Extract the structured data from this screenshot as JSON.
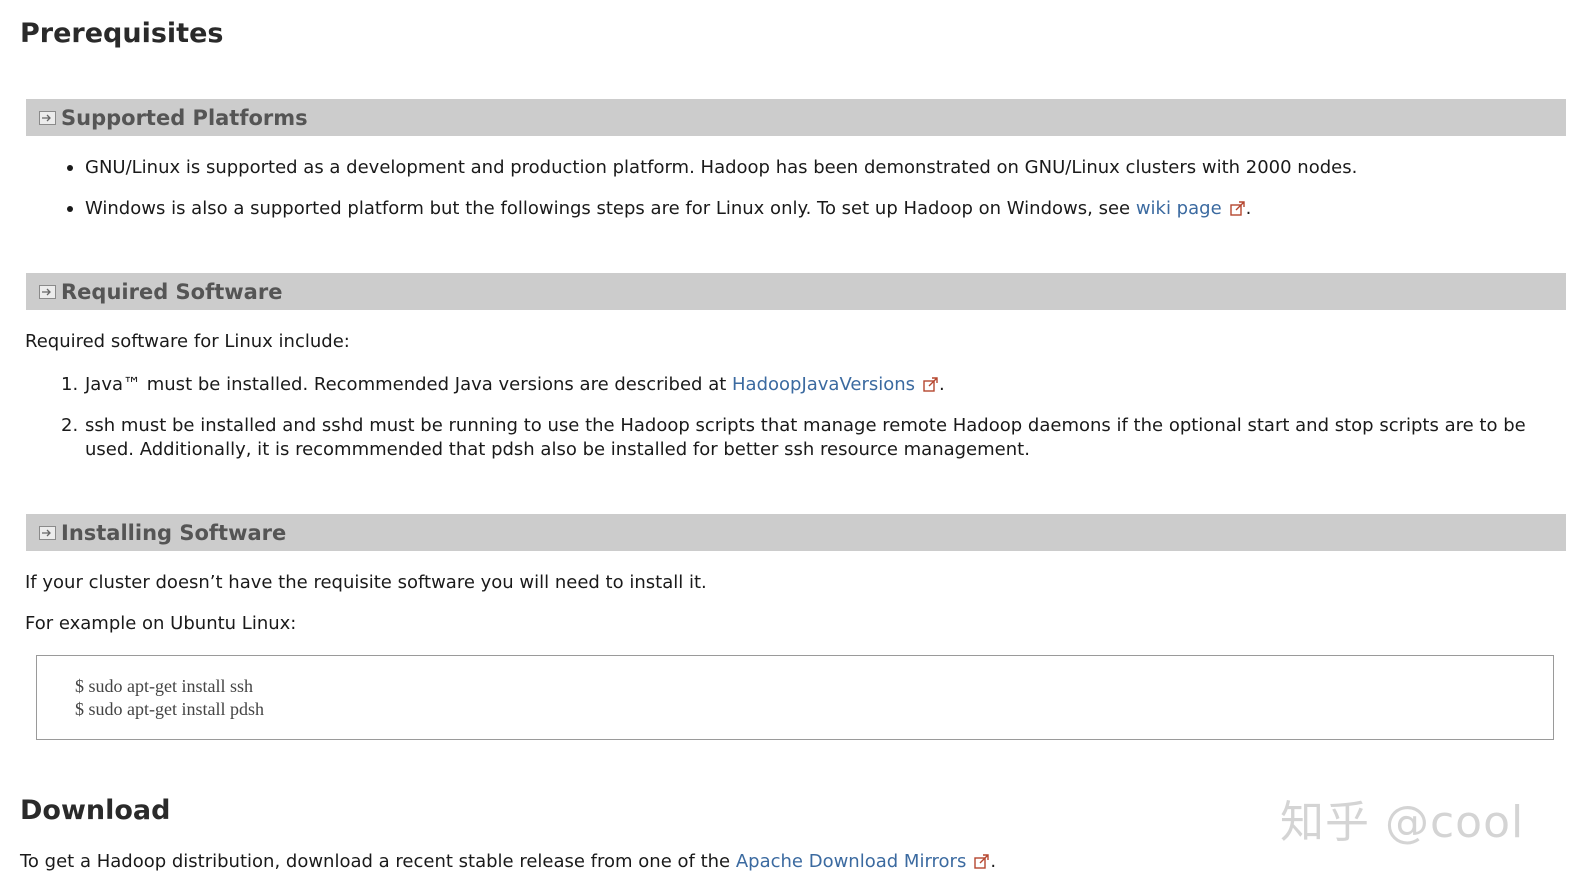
{
  "prerequisites": {
    "heading": "Prerequisites"
  },
  "supported_platforms": {
    "title": "Supported Platforms",
    "items": [
      {
        "text": "GNU/Linux is supported as a development and production platform. Hadoop has been demonstrated on GNU/Linux clusters with 2000 nodes."
      },
      {
        "text_before": "Windows is also a supported platform but the followings steps are for Linux only. To set up Hadoop on Windows, see ",
        "link": "wiki page",
        "text_after": "."
      }
    ]
  },
  "required_software": {
    "title": "Required Software",
    "intro": "Required software for Linux include:",
    "items": [
      {
        "number": "1.",
        "text_before": "Java™ must be installed. Recommended Java versions are described at ",
        "link": "HadoopJavaVersions",
        "text_after": "."
      },
      {
        "number": "2.",
        "line1": "ssh must be installed and sshd must be running to use the Hadoop scripts that manage remote Hadoop daemons if the optional start and stop scripts are to be",
        "line2": "used. Additionally, it is recommmended that pdsh also be installed for better ssh resource management."
      }
    ]
  },
  "installing_software": {
    "title": "Installing Software",
    "para1": "If your cluster doesn’t have the requisite software you will need to install it.",
    "para2": "For example on Ubuntu Linux:",
    "code": [
      "$ sudo apt-get install ssh",
      "$ sudo apt-get install pdsh"
    ]
  },
  "download": {
    "heading": "Download",
    "text_before": "To get a Hadoop distribution, download a recent stable release from one of the ",
    "link": "Apache Download Mirrors",
    "text_after": "."
  },
  "watermark": "知乎 @cool",
  "icons": {
    "section_toggle": "collapse-arrow-icon",
    "external_link": "external-link-icon"
  },
  "colors": {
    "section_bar": "#cccccc",
    "link": "#3b6aa0",
    "heading": "#2a2a2a"
  }
}
